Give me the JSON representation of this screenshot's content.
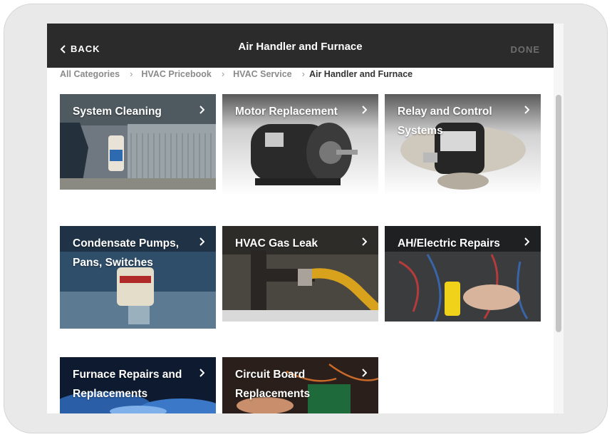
{
  "header": {
    "back_label": "BACK",
    "title": "Air Handler and Furnace",
    "done_label": "DONE"
  },
  "breadcrumb": [
    "All Categories",
    "HVAC Pricebook",
    "HVAC Service",
    "Air Handler and Furnace"
  ],
  "tiles": [
    {
      "label": "System Cleaning"
    },
    {
      "label": "Motor Replacement"
    },
    {
      "label": "Relay and Control Systems"
    },
    {
      "label": "Condensate Pumps, Pans, Switches"
    },
    {
      "label": "HVAC Gas Leak"
    },
    {
      "label": "AH/Electric Repairs"
    },
    {
      "label": "Furnace Repairs and Replacements"
    },
    {
      "label": "Circuit Board Replacements"
    }
  ],
  "colors": {
    "header_bg": "#2b2b2b",
    "done_disabled": "#6e6e6e",
    "breadcrumb_text": "#8a8a8a"
  },
  "icons": [
    "chevron-left-icon",
    "chevron-right-icon"
  ]
}
